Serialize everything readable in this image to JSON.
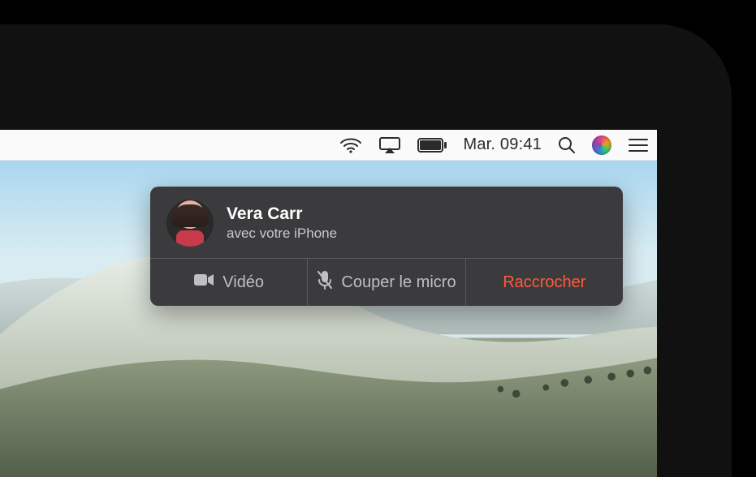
{
  "menubar": {
    "date_time": "Mar. 09:41",
    "icons": {
      "wifi": "wifi-icon",
      "airplay": "airplay-icon",
      "battery": "battery-icon",
      "spotlight": "search-icon",
      "siri": "siri-icon",
      "notification_center": "notification-center-icon"
    }
  },
  "call_notification": {
    "caller_name": "Vera Carr",
    "subtitle": "avec votre iPhone",
    "actions": {
      "video_label": "Vidéo",
      "mute_label": "Couper le micro",
      "hangup_label": "Raccrocher"
    }
  }
}
